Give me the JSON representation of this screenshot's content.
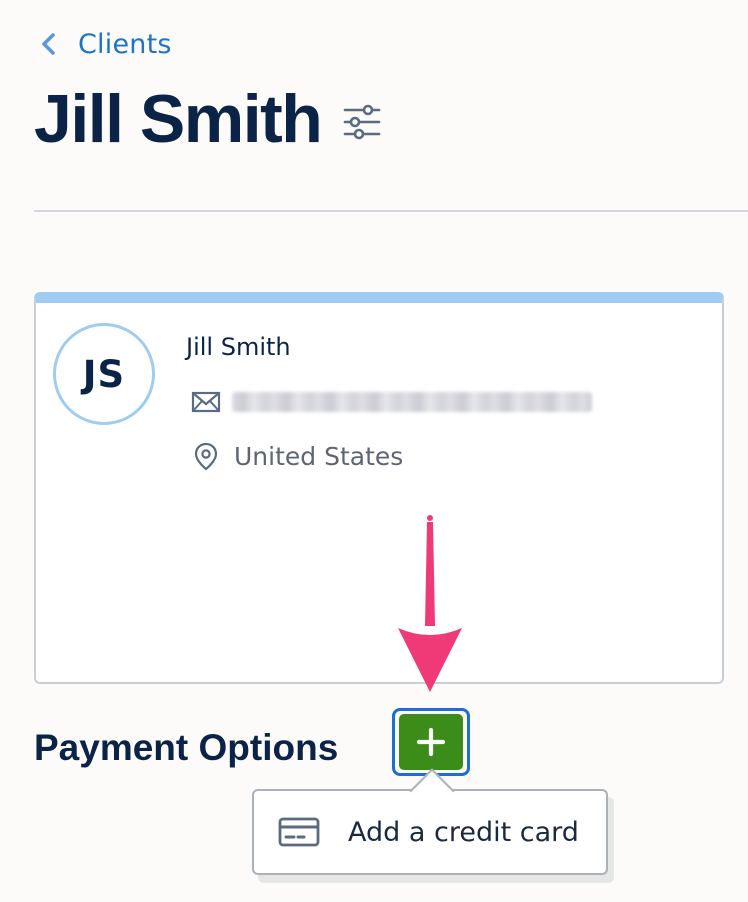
{
  "header": {
    "back_label": "Clients",
    "title": "Jill Smith",
    "filter_icon": "sliders-icon"
  },
  "client": {
    "initials": "JS",
    "name": "Jill Smith",
    "email": "(email hidden)",
    "location": "United States"
  },
  "payment": {
    "title": "Payment Options",
    "add_icon": "plus-icon",
    "menu": [
      {
        "label": "Add a credit card",
        "icon": "credit-card-icon"
      }
    ]
  },
  "colors": {
    "background": "#fcfbf9",
    "text_primary": "#0b2347",
    "link": "#1f74c4",
    "card_accent": "#9fccf2",
    "add_button": "#3c8c19",
    "focus_ring": "#1c6fd1",
    "annotation_arrow": "#f03a78"
  }
}
